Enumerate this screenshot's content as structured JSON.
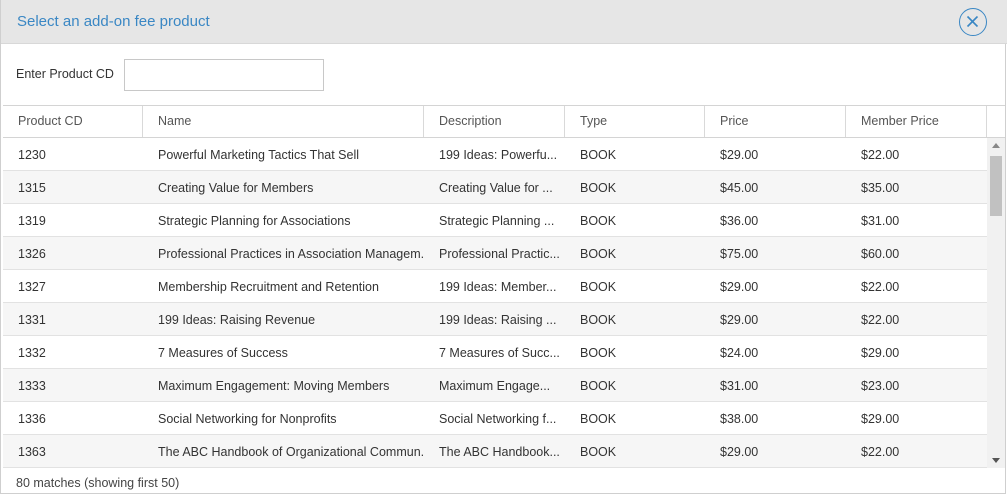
{
  "dialog": {
    "title": "Select an add-on fee product",
    "close_icon": "circle-x-icon"
  },
  "search": {
    "label": "Enter Product CD",
    "value": "",
    "placeholder": ""
  },
  "table": {
    "columns": [
      "Product CD",
      "Name",
      "Description",
      "Type",
      "Price",
      "Member Price"
    ],
    "rows": [
      [
        "1230",
        "Powerful Marketing Tactics That Sell",
        "199 Ideas: Powerfu...",
        "BOOK",
        "$29.00",
        "$22.00"
      ],
      [
        "1315",
        "Creating Value for Members",
        "Creating Value for ...",
        "BOOK",
        "$45.00",
        "$35.00"
      ],
      [
        "1319",
        "Strategic Planning for Associations",
        "Strategic Planning ...",
        "BOOK",
        "$36.00",
        "$31.00"
      ],
      [
        "1326",
        "Professional Practices in Association Managem...",
        "Professional Practic...",
        "BOOK",
        "$75.00",
        "$60.00"
      ],
      [
        "1327",
        "Membership Recruitment and Retention",
        "199 Ideas: Member...",
        "BOOK",
        "$29.00",
        "$22.00"
      ],
      [
        "1331",
        "199 Ideas: Raising Revenue",
        "199 Ideas: Raising ...",
        "BOOK",
        "$29.00",
        "$22.00"
      ],
      [
        "1332",
        "7 Measures of Success",
        "7 Measures of Succ...",
        "BOOK",
        "$24.00",
        "$29.00"
      ],
      [
        "1333",
        "Maximum Engagement: Moving Members",
        "Maximum Engage...",
        "BOOK",
        "$31.00",
        "$23.00"
      ],
      [
        "1336",
        "Social Networking for Nonprofits",
        "Social Networking f...",
        "BOOK",
        "$38.00",
        "$29.00"
      ],
      [
        "1363",
        "The ABC Handbook of Organizational Commun...",
        "The ABC Handbook...",
        "BOOK",
        "$29.00",
        "$22.00"
      ]
    ]
  },
  "footer": {
    "status": "80 matches (showing first 50)"
  },
  "colors": {
    "accent": "#3a87c4",
    "titlebar_bg": "#e6e6e6",
    "row_alt_bg": "#f6f6f6"
  }
}
